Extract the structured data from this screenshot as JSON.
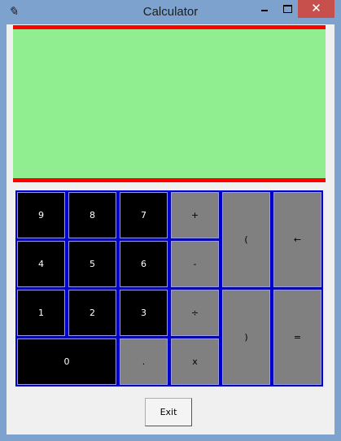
{
  "window": {
    "title": "Calculator",
    "app_icon": "feather-icon",
    "controls": {
      "minimize": "minimize-icon",
      "maximize": "maximize-icon",
      "close": "✕"
    }
  },
  "display": {
    "value": "",
    "background": "#90ee90",
    "border_color": "#ff0000"
  },
  "keypad": {
    "background": "#0000cc",
    "keys": {
      "k9": "9",
      "k8": "8",
      "k7": "7",
      "plus": "+",
      "k4": "4",
      "k5": "5",
      "k6": "6",
      "minus": "-",
      "k1": "1",
      "k2": "2",
      "k3": "3",
      "divide": "÷",
      "k0": "0",
      "dot": ".",
      "multiply": "x",
      "lparen": "(",
      "backspace": "←",
      "rparen": ")",
      "equals": "="
    }
  },
  "exit_label": "Exit"
}
